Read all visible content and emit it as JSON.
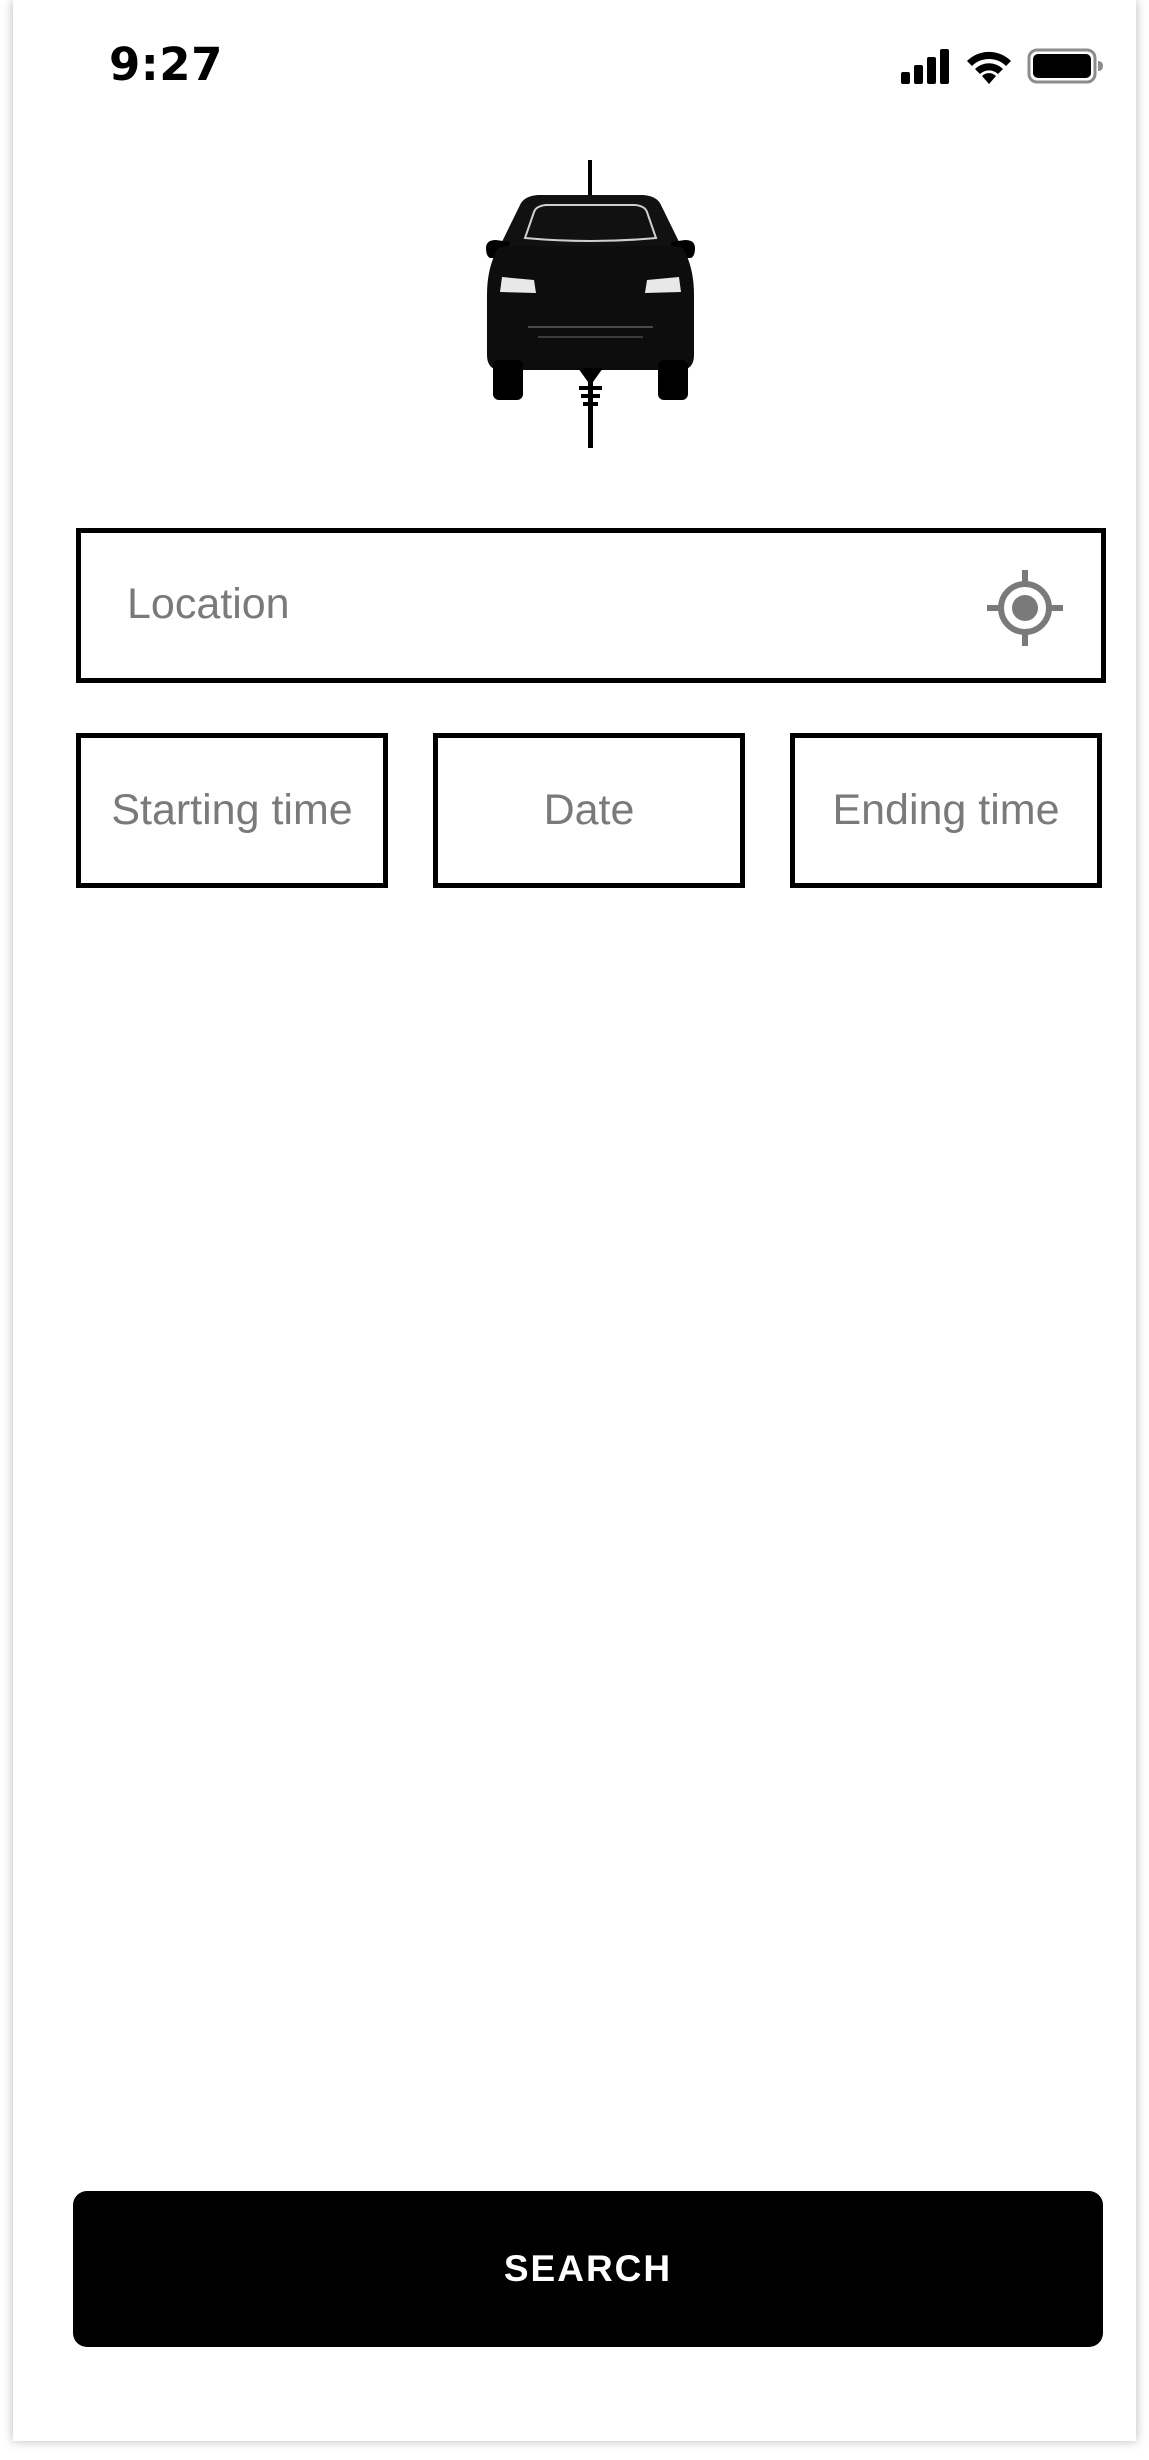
{
  "status_bar": {
    "time": "9:27",
    "icons": [
      "cellular-signal-icon",
      "wifi-icon",
      "battery-icon"
    ]
  },
  "logo": {
    "icon": "electric-car-plug-logo"
  },
  "location": {
    "placeholder": "Location",
    "icon": "gps-target-icon"
  },
  "time_fields": {
    "starting_time_placeholder": "Starting time",
    "date_placeholder": "Date",
    "ending_time_placeholder": "Ending time"
  },
  "search_button": {
    "label": "SEARCH"
  },
  "colors": {
    "primary": "#000000",
    "placeholder": "#7a7a7a",
    "background": "#ffffff",
    "button_text": "#ffffff"
  }
}
